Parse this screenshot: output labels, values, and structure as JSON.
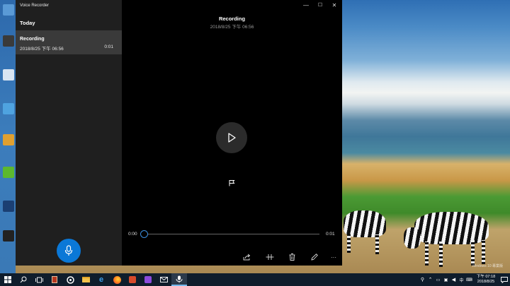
{
  "window": {
    "app_title": "Voice Recorder",
    "minimize_glyph": "—",
    "maximize_glyph": "☐",
    "close_glyph": "✕"
  },
  "sidebar": {
    "section_header": "Today",
    "items": [
      {
        "name": "Recording",
        "date": "2018/8/25 下午 06:56",
        "duration": "0:01"
      }
    ],
    "record_button_icon": "microphone-icon"
  },
  "player": {
    "title": "Recording",
    "date": "2018/8/25 下午 06:56",
    "time_start": "0:00",
    "time_end": "0:01",
    "progress": 0,
    "play_icon": "play-icon",
    "marker_icon": "flag-icon",
    "commands": [
      "share-icon",
      "trim-icon",
      "delete-icon",
      "rename-icon",
      "more-icon"
    ],
    "more_glyph": "···"
  },
  "taskbar": {
    "clock_time": "下午 07:18",
    "clock_date": "2018/8/25",
    "apps": [
      "start-icon",
      "search-icon",
      "task-view-icon",
      "app-icon",
      "settings-icon",
      "file-explorer-icon",
      "edge-icon",
      "firefox-icon",
      "media-icon",
      "twitch-icon",
      "mail-icon",
      "voice-recorder-icon"
    ]
  },
  "desktop": {
    "watermark": "Windows 10 專業版"
  },
  "colors": {
    "accent": "#0a78d7",
    "sidebar_bg": "#1f1f1f",
    "selected_item_bg": "#3a3a3a",
    "taskbar_bg": "#0f1d2c"
  }
}
